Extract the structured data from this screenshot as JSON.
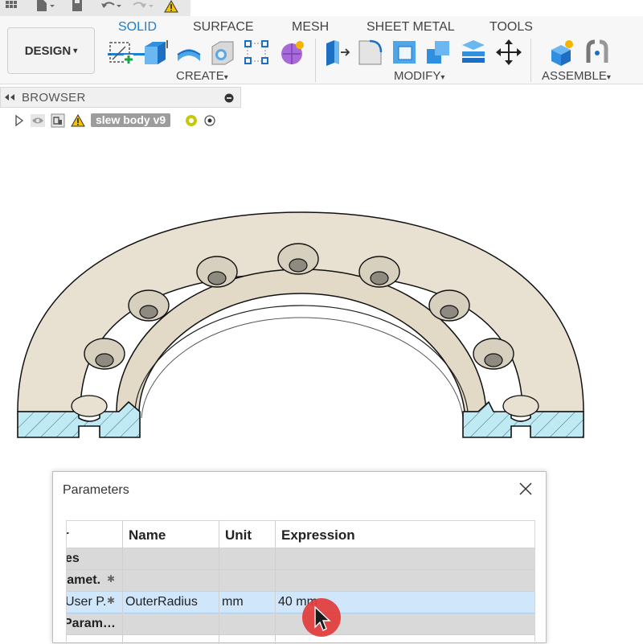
{
  "toolbar": {
    "workspace_label": "DESIGN",
    "workspace_caret": "▾",
    "tabs": [
      "SOLID",
      "SURFACE",
      "MESH",
      "SHEET METAL",
      "TOOLS"
    ],
    "groups": {
      "create": "CREATE",
      "modify": "MODIFY",
      "assemble": "ASSEMBLE"
    },
    "caret": "▾"
  },
  "browser": {
    "title": "BROWSER",
    "document_name": "slew body v9"
  },
  "dialog": {
    "title": "Parameters",
    "columns": [
      "r",
      "Name",
      "Unit",
      "Expression"
    ],
    "rows": [
      {
        "param": "es",
        "name": "",
        "unit": "",
        "expression": ""
      },
      {
        "param": "ramet.",
        "star": "✱",
        "name": "",
        "unit": "",
        "expression": ""
      },
      {
        "param": "User P.",
        "star": "✱",
        "name": "OuterRadius",
        "unit": "mm",
        "expression": "40 mm"
      },
      {
        "param": "Param…",
        "name": "",
        "unit": "",
        "expression": ""
      }
    ]
  },
  "colors": {
    "accent": "#1b7fd2",
    "model_face": "#e8e1d2",
    "section_hatch": "#bfeaf3",
    "selected_row": "#cfe6fb",
    "cursor_highlight": "#e23b3b"
  }
}
